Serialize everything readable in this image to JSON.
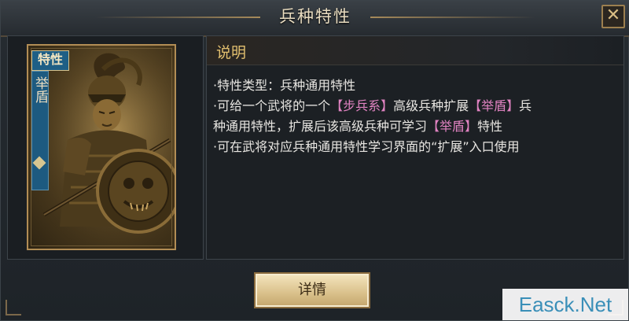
{
  "dialog": {
    "title": "兵种特性",
    "close_glyph": "✕"
  },
  "card": {
    "tag": "特性",
    "name": "举盾"
  },
  "description": {
    "header": "说明",
    "line1": "·特性类型：兵种通用特性",
    "line2": {
      "p1": "·可给一个武将的一个",
      "h1": "【步兵系】",
      "p2": "高级兵种扩展",
      "h2": "【举盾】",
      "p3": "兵"
    },
    "line3": {
      "p1": "种通用特性，扩展后该高级兵种可学习",
      "h1": "【举盾】",
      "p2": "特性"
    },
    "line4": "·可在武将对应兵种通用特性学习界面的“扩展”入口使用"
  },
  "buttons": {
    "detail": "详情"
  },
  "watermark": "Easck.Net",
  "colors": {
    "highlight": "#e183c2",
    "header_gold": "#e3c06f",
    "card_tag_blue": "#1e5f86"
  }
}
